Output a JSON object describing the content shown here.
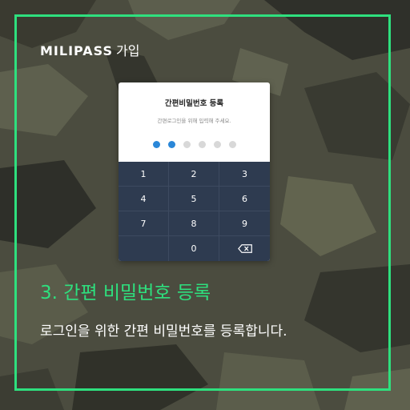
{
  "brand": {
    "name": "MILIPASS",
    "suffix": "가입"
  },
  "pin_screen": {
    "title": "간편비밀번호 등록",
    "subtitle": "간편로그인을 위해 입력해 주세요.",
    "pin_length": 6,
    "pin_filled": 2,
    "accent_color": "#2a87d8",
    "keys": [
      "1",
      "2",
      "3",
      "4",
      "5",
      "6",
      "7",
      "8",
      "9",
      "",
      "0",
      "backspace-icon"
    ]
  },
  "step": {
    "title": "3. 간편 비밀번호 등록",
    "description": "로그인을 위한 간편 비밀번호를 등록합니다."
  },
  "colors": {
    "frame": "#2ee07e",
    "keypad": "#2e3b50"
  }
}
